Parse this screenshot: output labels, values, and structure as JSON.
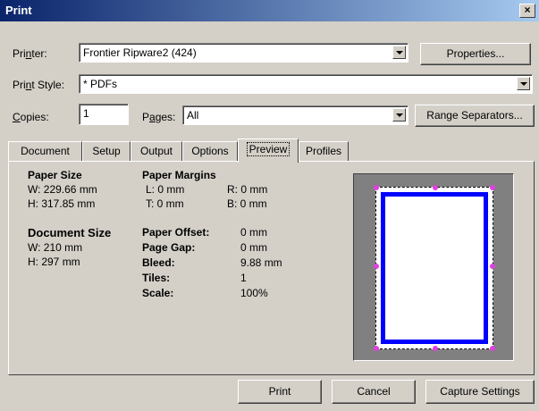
{
  "window": {
    "title": "Print",
    "close_glyph": "×"
  },
  "printer": {
    "label": "Printer:",
    "value": "Frontier Ripware2 (424)",
    "properties_button": "Properties..."
  },
  "print_style": {
    "label": "Print Style:",
    "value": "* PDFs"
  },
  "copies": {
    "label": "Copies:",
    "value": "1"
  },
  "pages": {
    "label": "Pages:",
    "value": "All",
    "range_button": "Range Separators..."
  },
  "tabs": [
    {
      "label": "Document",
      "active": false
    },
    {
      "label": "Setup",
      "active": false
    },
    {
      "label": "Output",
      "active": false
    },
    {
      "label": "Options",
      "active": false
    },
    {
      "label": "Preview",
      "active": true
    },
    {
      "label": "Profiles",
      "active": false
    }
  ],
  "preview_tab": {
    "paper_size": {
      "heading": "Paper Size",
      "w": "W: 229.66 mm",
      "h": "H: 317.85 mm"
    },
    "paper_margins": {
      "heading": "Paper Margins",
      "l": "L: 0 mm",
      "r": "R:  0 mm",
      "t": "T: 0 mm",
      "b": "B:  0 mm"
    },
    "document_size": {
      "heading": "Document Size",
      "w": "W: 210 mm",
      "h": "H: 297 mm"
    },
    "details": [
      {
        "label": "Paper Offset:",
        "value": "0 mm"
      },
      {
        "label": "Page Gap:",
        "value": "0 mm"
      },
      {
        "label": "Bleed:",
        "value": "9.88 mm"
      },
      {
        "label": "Tiles:",
        "value": "1"
      },
      {
        "label": "Scale:",
        "value": "100%"
      }
    ],
    "colors": {
      "page_frame": "#0000ff",
      "handles": "#e040e0",
      "preview_bg": "#808080"
    }
  },
  "buttons": {
    "print": "Print",
    "cancel": "Cancel",
    "capture": "Capture Settings"
  }
}
